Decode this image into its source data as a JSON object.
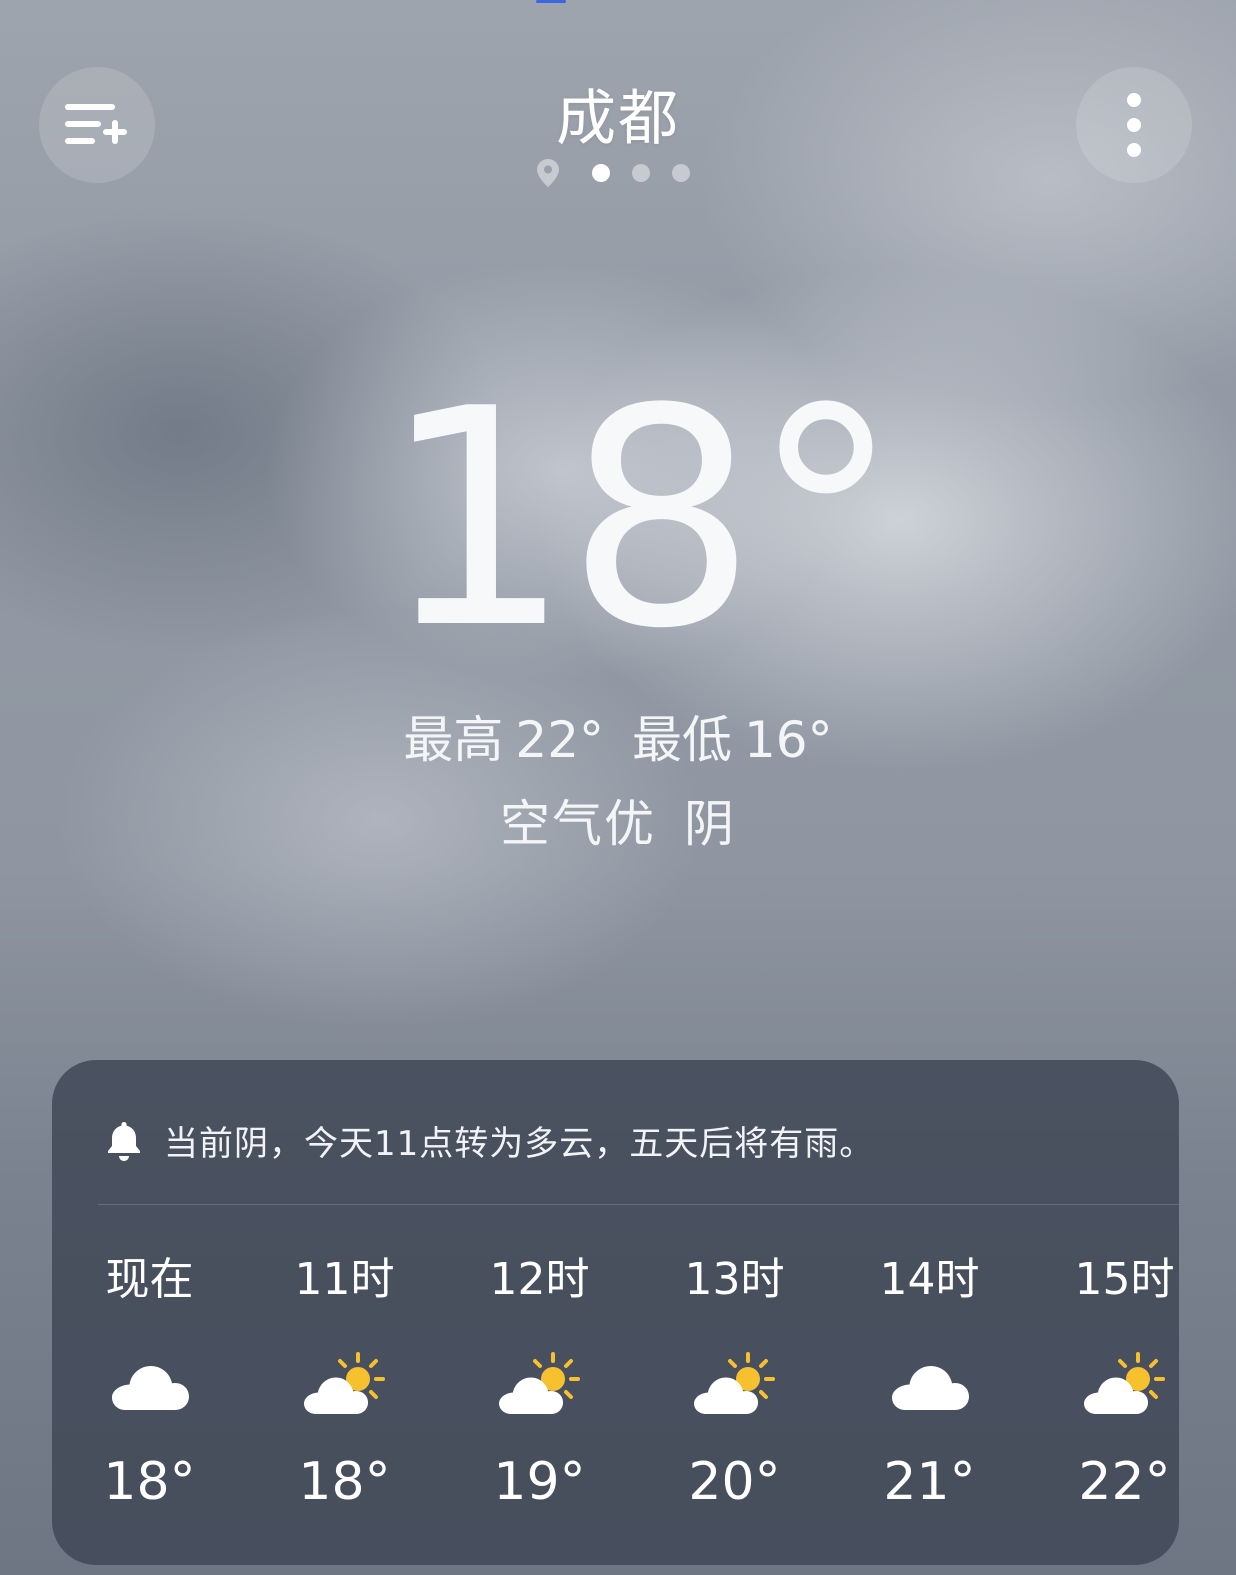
{
  "header": {
    "city": "成都",
    "pages": {
      "count": 3,
      "active_index": 0
    }
  },
  "current": {
    "temperature": "18°",
    "high_label": "最高",
    "high_value": "22°",
    "low_label": "最低",
    "low_value": "16°",
    "air_quality": "空气优",
    "condition": "阴"
  },
  "forecast": {
    "notice": "当前阴，今天11点转为多云，五天后将有雨。",
    "hours": [
      {
        "label": "现在",
        "icon": "cloud-icon",
        "temp": "18°"
      },
      {
        "label": "11时",
        "icon": "partly-cloudy-icon",
        "temp": "18°"
      },
      {
        "label": "12时",
        "icon": "partly-cloudy-icon",
        "temp": "19°"
      },
      {
        "label": "13时",
        "icon": "partly-cloudy-icon",
        "temp": "20°"
      },
      {
        "label": "14时",
        "icon": "cloud-icon",
        "temp": "21°"
      },
      {
        "label": "15时",
        "icon": "partly-cloudy-icon",
        "temp": "22°"
      }
    ]
  },
  "colors": {
    "sun": "#f6c02f",
    "card": "#3e4654"
  }
}
